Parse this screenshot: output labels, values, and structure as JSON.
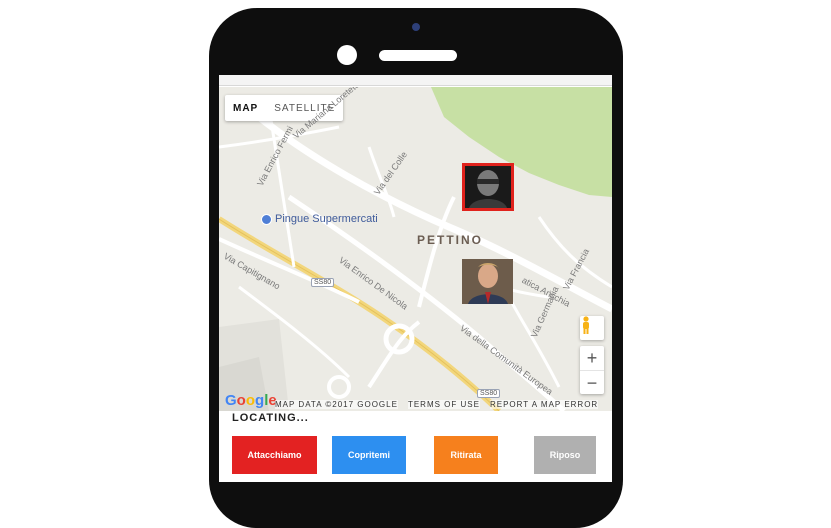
{
  "map": {
    "type_map_label": "MAP",
    "type_satellite_label": "SATELLITE",
    "poi_label": "Pingue Supermercati",
    "district_label": "PETTINO",
    "streets": {
      "via_enrico_fermi": "Via Enrico Fermi",
      "via_del_colle": "Via del Colle",
      "via_enrico_de_nicola": "Via Enrico De Nicola",
      "via_capitignano": "Via Capitignano",
      "via_comunita_europea": "Via della Comunità Europea",
      "via_mariana": "Via Mariana Loreteto",
      "via_francia": "Via Francia",
      "via_germania": "Via Germania",
      "via_austria": "atica Anschia"
    },
    "road_shield_1": "SS80",
    "road_shield_2": "SS80",
    "zoom_in": "+",
    "zoom_out": "−",
    "google_logo": [
      "G",
      "o",
      "o",
      "g",
      "l",
      "e"
    ],
    "attribution": {
      "map_data": "MAP DATA ©2017 GOOGLE",
      "terms": "TERMS OF USE",
      "report": "REPORT A MAP ERROR"
    }
  },
  "status_text": "LOCATING...",
  "buttons": {
    "attack": "Attacchiamo",
    "cover": "Copritemi",
    "retreat": "Ritirata",
    "rest": "Riposo"
  },
  "colors": {
    "attack": "#e32222",
    "cover": "#2d8ff0",
    "retreat": "#f6801d",
    "rest": "#b0b0b0",
    "marker_border": "#e0221c"
  },
  "icons": {
    "pegman": "pegman-icon",
    "poi": "shopping-pin-icon"
  }
}
